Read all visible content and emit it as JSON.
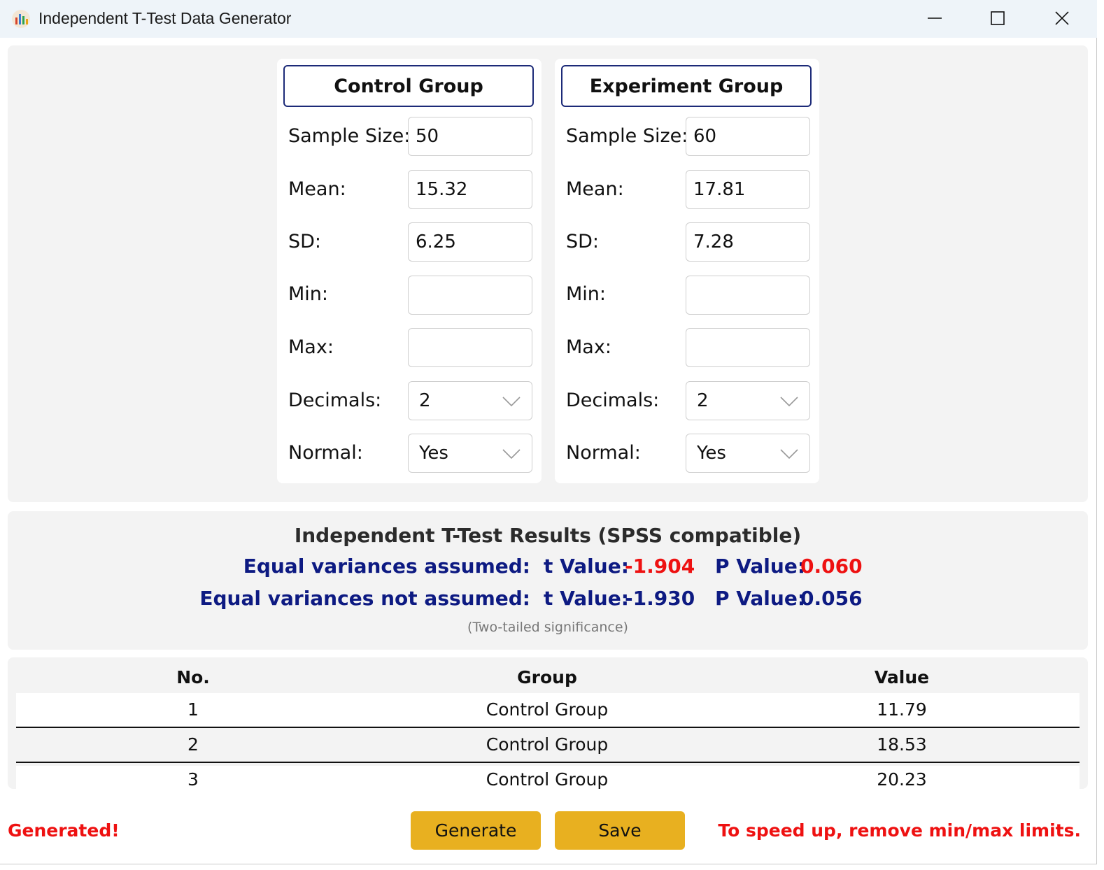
{
  "window": {
    "title": "Independent T-Test Data Generator",
    "icon": "bar-chart-icon"
  },
  "groups": [
    {
      "header": "Control Group",
      "fields": {
        "sample_size_label": "Sample Size:",
        "sample_size": "50",
        "mean_label": "Mean:",
        "mean": "15.32",
        "sd_label": "SD:",
        "sd": "6.25",
        "min_label": "Min:",
        "min": "",
        "max_label": "Max:",
        "max": "",
        "decimals_label": "Decimals:",
        "decimals": "2",
        "normal_label": "Normal:",
        "normal": "Yes"
      }
    },
    {
      "header": "Experiment Group",
      "fields": {
        "sample_size_label": "Sample Size:",
        "sample_size": "60",
        "mean_label": "Mean:",
        "mean": "17.81",
        "sd_label": "SD:",
        "sd": "7.28",
        "min_label": "Min:",
        "min": "",
        "max_label": "Max:",
        "max": "",
        "decimals_label": "Decimals:",
        "decimals": "2",
        "normal_label": "Normal:",
        "normal": "Yes"
      }
    }
  ],
  "results": {
    "title": "Independent T-Test Results (SPSS compatible)",
    "equal": {
      "label": "Equal variances assumed:",
      "t_label": "t Value:",
      "t_value": "-1.904",
      "p_label": "P Value:",
      "p_value": "0.060"
    },
    "unequal": {
      "label": "Equal variances not assumed:",
      "t_label": "t Value:",
      "t_value": "-1.930",
      "p_label": "P Value:",
      "p_value": "0.056"
    },
    "note": "(Two-tailed significance)"
  },
  "table": {
    "columns": [
      "No.",
      "Group",
      "Value"
    ],
    "rows": [
      [
        "1",
        "Control Group",
        "11.79"
      ],
      [
        "2",
        "Control Group",
        "18.53"
      ],
      [
        "3",
        "Control Group",
        "20.23"
      ]
    ]
  },
  "footer": {
    "status": "Generated!",
    "generate_label": "Generate",
    "save_label": "Save",
    "hint": "To speed up, remove min/max limits."
  },
  "colors": {
    "accent_button": "#e8b020",
    "header_border": "#1c2a78",
    "result_text": "#0d1a82",
    "highlight_red": "#ee1111"
  }
}
